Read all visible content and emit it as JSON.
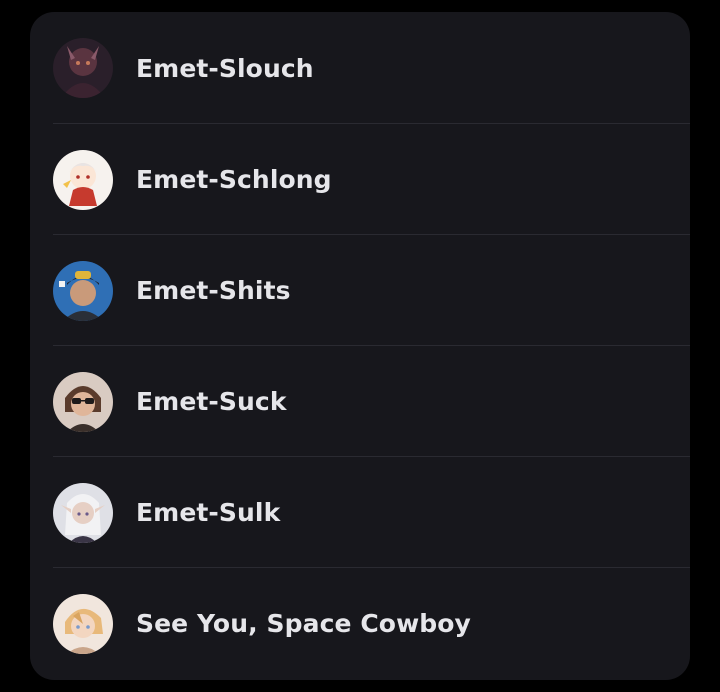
{
  "contacts": [
    {
      "name": "Emet-Slouch",
      "avatar_icon": "dark-horned-character-avatar-icon"
    },
    {
      "name": "Emet-Schlong",
      "avatar_icon": "chibi-white-hair-character-avatar-icon"
    },
    {
      "name": "Emet-Shits",
      "avatar_icon": "man-with-cap-avatar-icon"
    },
    {
      "name": "Emet-Suck",
      "avatar_icon": "man-with-sunglasses-avatar-icon"
    },
    {
      "name": "Emet-Sulk",
      "avatar_icon": "white-hair-elf-avatar-icon"
    },
    {
      "name": "See You, Space Cowboy",
      "avatar_icon": "blonde-character-avatar-icon"
    }
  ]
}
